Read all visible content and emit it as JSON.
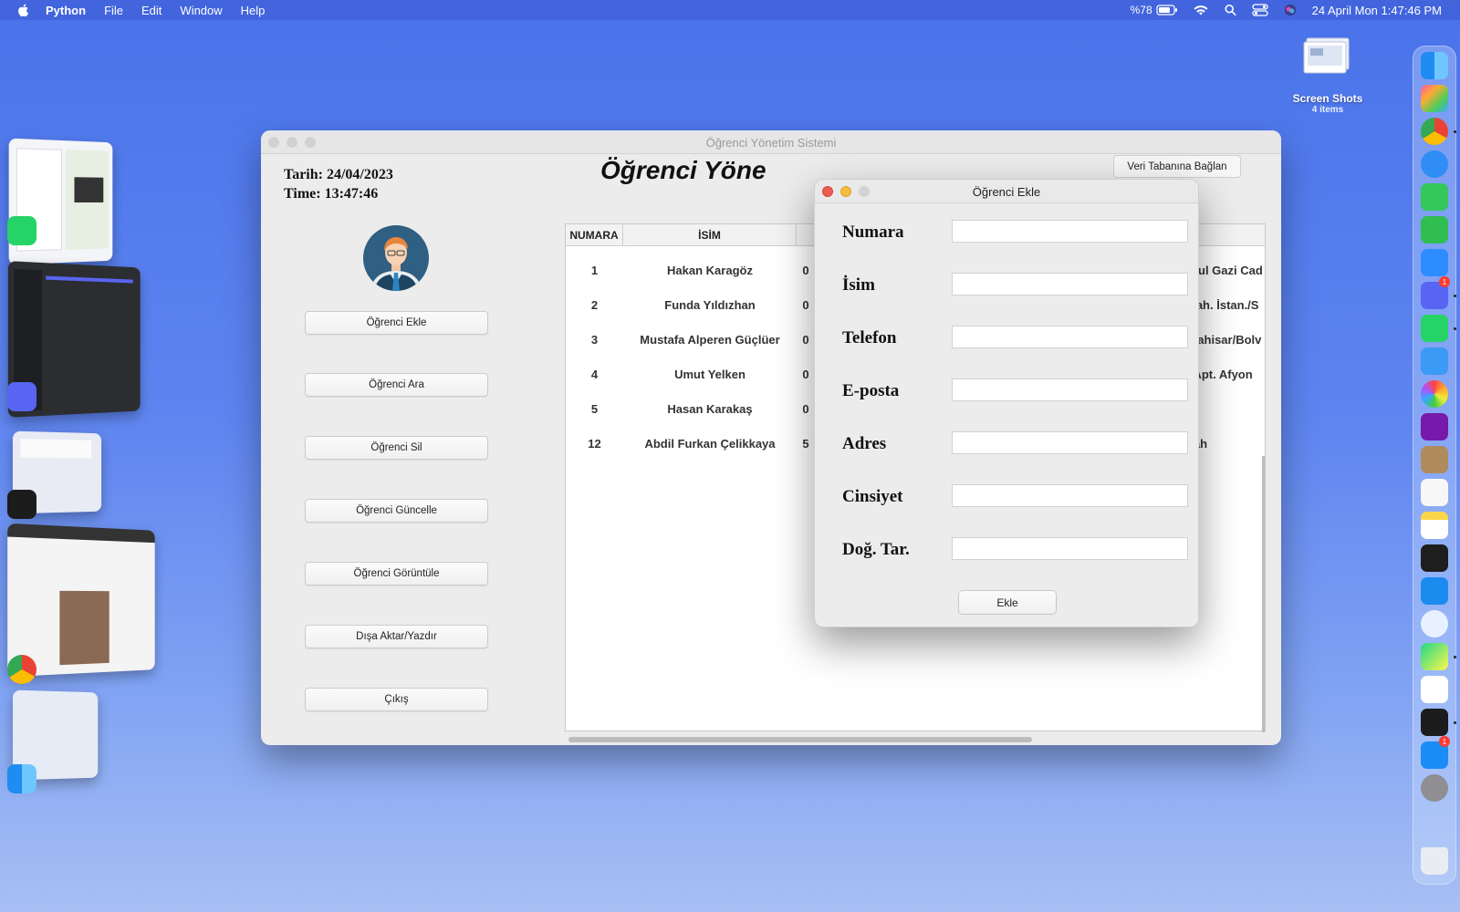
{
  "menubar": {
    "app_name": "Python",
    "items": [
      "File",
      "Edit",
      "Window",
      "Help"
    ],
    "battery": "%78",
    "clock": "24 April Mon  1:47:46 PM"
  },
  "desktop": {
    "folder_name": "Screen Shots",
    "folder_count": "4 items"
  },
  "window": {
    "title": "Öğrenci Yönetim Sistemi",
    "date_line": "Tarih: 24/04/2023",
    "time_line": "Time: 13:47:46",
    "heading": "Öğrenci Yöne",
    "db_button": "Veri Tabanına Bağlan",
    "side_buttons": {
      "add": "Öğrenci Ekle",
      "search": "Öğrenci Ara",
      "delete": "Öğrenci Sil",
      "update": "Öğrenci Güncelle",
      "view": "Öğrenci Görüntüle",
      "export": "Dışa Aktar/Yazdır",
      "exit": "Çıkış"
    },
    "table": {
      "headers": {
        "numara": "NUMARA",
        "isim": "İSİM",
        "adres": "S"
      },
      "rows": [
        {
          "numara": "1",
          "isim": "Hakan Karagöz",
          "tel": "0",
          "adres": "grul Gazi Cad"
        },
        {
          "numara": "2",
          "isim": "Funda Yıldızhan",
          "tel": "0",
          "adres": "Mah. İstan./S"
        },
        {
          "numara": "3",
          "isim": "Mustafa Alperen Güçlüer",
          "tel": "0",
          "adres": "arahisar/Bolv"
        },
        {
          "numara": "4",
          "isim": "Umut Yelken",
          "tel": "0",
          "adres": "t Apt. Afyon"
        },
        {
          "numara": "5",
          "isim": "Hasan Karakaş",
          "tel": "0",
          "adres": "n"
        },
        {
          "numara": "12",
          "isim": "Abdil Furkan Çelikkaya",
          "tel": "5",
          "adres": "nah"
        }
      ]
    }
  },
  "dialog": {
    "title": "Öğrenci Ekle",
    "fields": {
      "numara": {
        "label": "Numara",
        "value": ""
      },
      "isim": {
        "label": "İsim",
        "value": ""
      },
      "telefon": {
        "label": "Telefon",
        "value": ""
      },
      "eposta": {
        "label": "E-posta",
        "value": ""
      },
      "adres": {
        "label": "Adres",
        "value": ""
      },
      "cinsiyet": {
        "label": "Cinsiyet",
        "value": ""
      },
      "dogum": {
        "label": "Doğ. Tar.",
        "value": ""
      }
    },
    "submit": "Ekle"
  },
  "dock": {
    "badges": {
      "discord": "1",
      "appstore": "1"
    }
  },
  "colors": {
    "desktop_top": "#4a73ea",
    "desktop_bottom": "#a7bff3",
    "window_bg": "#ececec",
    "close_red": "#ee5b52",
    "minimize_yellow": "#f4bd3f"
  }
}
